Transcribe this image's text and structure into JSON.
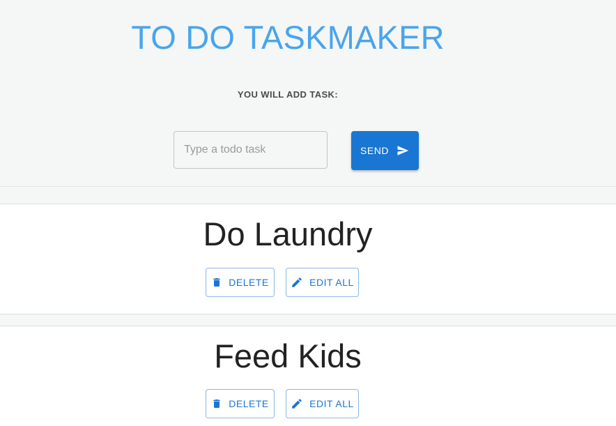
{
  "header": {
    "title": "TO DO TASKMAKER",
    "add_label": "YOU WILL ADD TASK:"
  },
  "form": {
    "input_placeholder": "Type a todo task",
    "input_value": "",
    "send_label": "SEND"
  },
  "tasks": [
    {
      "name": "Do Laundry",
      "delete_label": "DELETE",
      "edit_label": "EDIT ALL"
    },
    {
      "name": "Feed Kids",
      "delete_label": "DELETE",
      "edit_label": "EDIT ALL"
    }
  ],
  "icons": {
    "send": "send-icon",
    "delete": "trash-icon",
    "edit": "pencil-icon"
  },
  "colors": {
    "title": "#49a5ec",
    "primary": "#1976d2",
    "background": "#f5f6f6",
    "card": "#ffffff"
  }
}
